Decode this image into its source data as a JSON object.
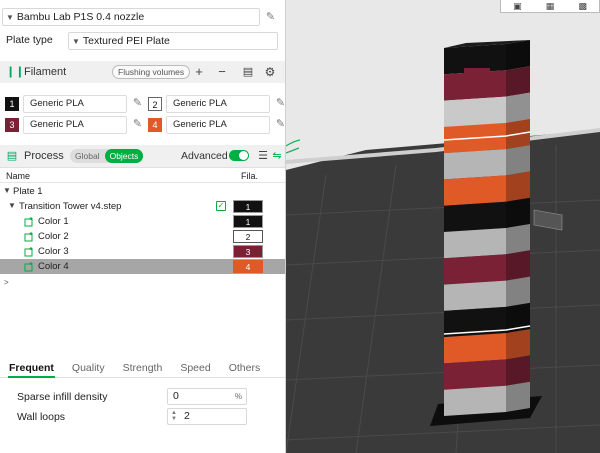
{
  "printer": {
    "name": "Bambu Lab P1S 0.4 nozzle"
  },
  "plate": {
    "label": "Plate type",
    "value": "Textured PEI Plate"
  },
  "filament": {
    "title": "Filament",
    "flush_label": "Flushing volumes",
    "add_symbol": "+",
    "remove_symbol": "−",
    "slots": [
      {
        "num": "1",
        "name": "Generic PLA",
        "color": "#111111"
      },
      {
        "num": "2",
        "name": "Generic PLA",
        "color": "#ffffff"
      },
      {
        "num": "3",
        "name": "Generic PLA",
        "color": "#7a2136"
      },
      {
        "num": "4",
        "name": "Generic PLA",
        "color": "#e05a28"
      }
    ]
  },
  "process": {
    "title": "Process",
    "toggle_global": "Global",
    "toggle_objects": "Objects",
    "advanced_label": "Advanced"
  },
  "tree": {
    "col_name": "Name",
    "col_fila": "Fila.",
    "plate": "Plate 1",
    "object": {
      "name": "Transition Tower v4.step",
      "fila": "1"
    },
    "parts": [
      {
        "name": "Color 1",
        "fila": "1",
        "color": "#111111"
      },
      {
        "name": "Color 2",
        "fila": "2",
        "color": "#ffffff"
      },
      {
        "name": "Color 3",
        "fila": "3",
        "color": "#7a2136"
      },
      {
        "name": "Color 4",
        "fila": "4",
        "color": "#e05a28"
      }
    ],
    "expand_arrow": ">"
  },
  "tabs": [
    "Frequent",
    "Quality",
    "Strength",
    "Speed",
    "Others"
  ],
  "settings": {
    "infill": {
      "label": "Sparse infill density",
      "value": "0",
      "unit": "%"
    },
    "walls": {
      "label": "Wall loops",
      "value": "2"
    }
  },
  "colors": {
    "accent": "#00ae42",
    "black": "#111111",
    "white": "#ffffff",
    "maroon": "#7a2136",
    "orange": "#e05a28"
  }
}
